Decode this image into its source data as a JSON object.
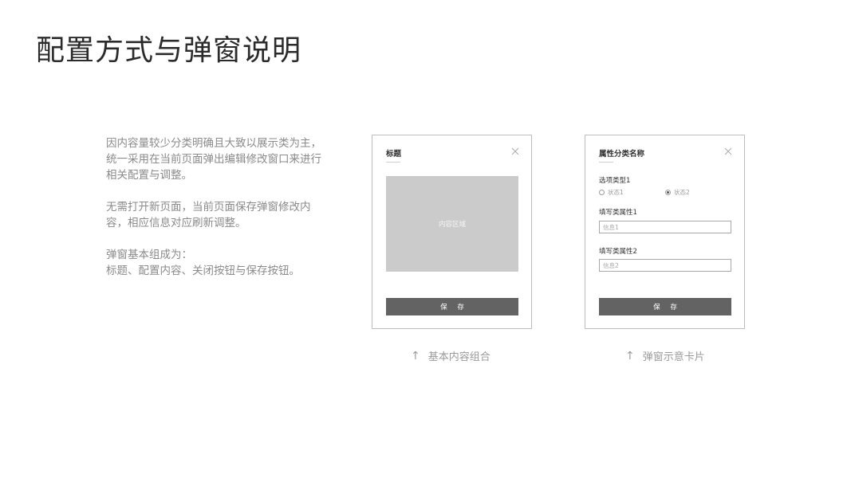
{
  "page": {
    "title": "配置方式与弹窗说明"
  },
  "description": {
    "paragraphs": [
      "因内容量较少分类明确且大致以展示类为主，\n统一采用在当前页面弹出编辑修改窗口来进行\n相关配置与调整。",
      "无需打开新页面，当前页面保存弹窗修改内\n容，相应信息对应刷新调整。",
      "弹窗基本组成为：\n标题、配置内容、关闭按钮与保存按钮。"
    ]
  },
  "modal_basic": {
    "title": "标题",
    "content_label": "内容区域",
    "save_label": "保 存",
    "caption": "基本内容组合",
    "close_icon": "close-icon",
    "caption_icon": "arrow-up-icon"
  },
  "modal_example": {
    "title": "属性分类名称",
    "option_label": "选项类型1",
    "radios": [
      {
        "label": "状态1",
        "selected": false
      },
      {
        "label": "状态2",
        "selected": true
      }
    ],
    "field1_label": "填写类属性1",
    "field1_placeholder": "信息1",
    "field2_label": "填写类属性2",
    "field2_placeholder": "信息2",
    "save_label": "保 存",
    "caption": "弹窗示意卡片",
    "close_icon": "close-icon",
    "caption_icon": "arrow-up-icon"
  },
  "colors": {
    "button_bg": "#636363",
    "content_area_bg": "#cbcbcb",
    "border": "#bdbdbd",
    "caption_text": "#9a9a9a"
  }
}
